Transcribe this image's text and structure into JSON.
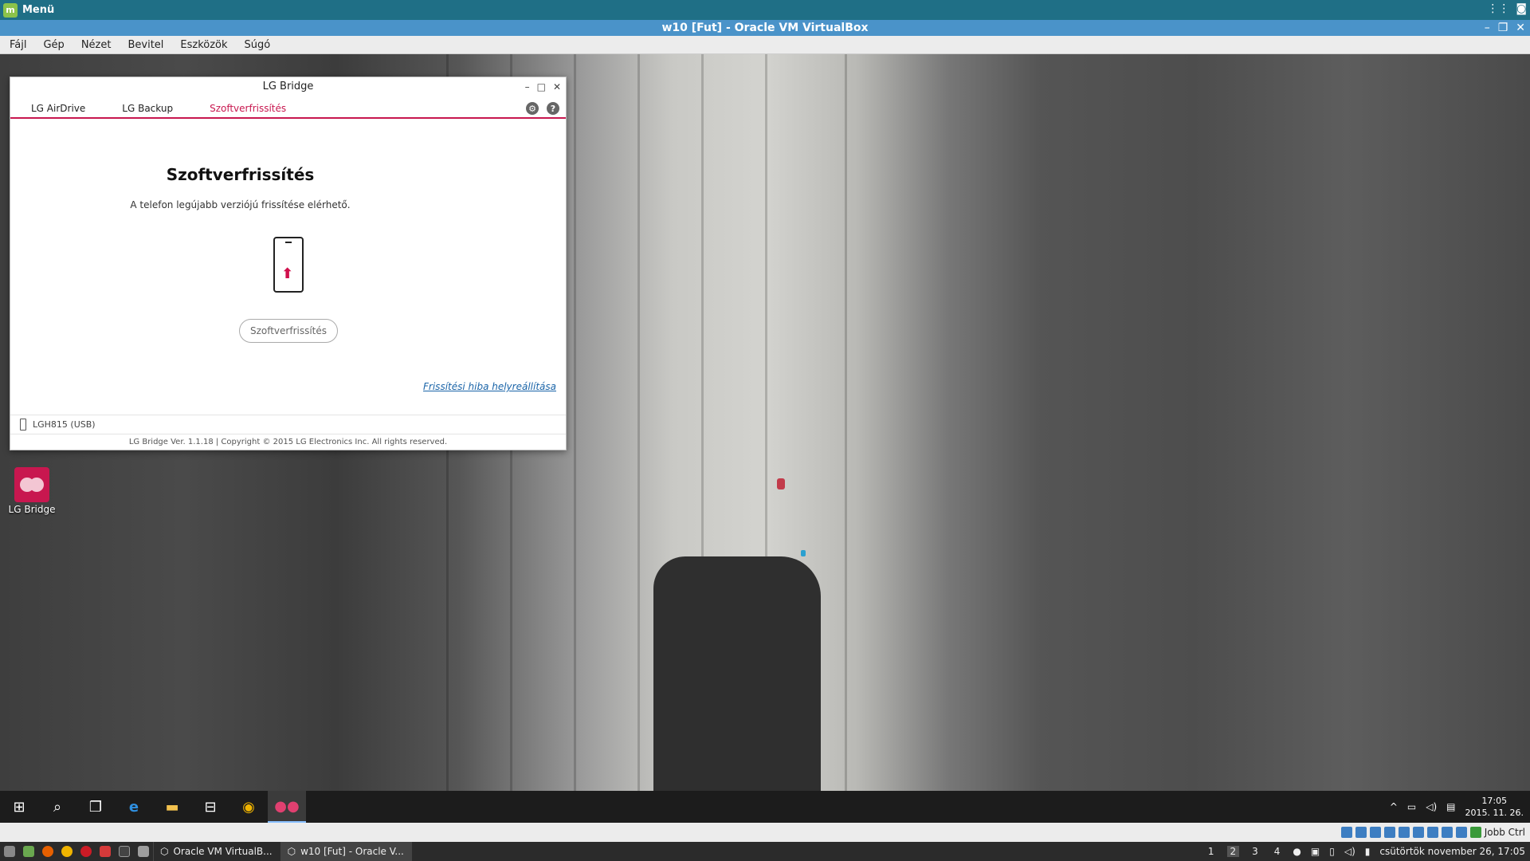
{
  "host_top": {
    "menu_label": "Menü"
  },
  "vbox": {
    "title": "w10 [Fut] - Oracle VM VirtualBox",
    "menu": [
      "Fájl",
      "Gép",
      "Nézet",
      "Bevitel",
      "Eszközök",
      "Súgó"
    ],
    "host_key_label": "Jobb Ctrl"
  },
  "desktop": {
    "lg_bridge_label": "LG Bridge"
  },
  "lg_bridge": {
    "title": "LG Bridge",
    "tabs": [
      "LG AirDrive",
      "LG Backup",
      "Szoftverfrissítés"
    ],
    "active_tab": "Szoftverfrissítés",
    "heading": "Szoftverfrissítés",
    "description": "A telefon legújabb verziójú frissítése elérhető.",
    "update_button": "Szoftverfrissítés",
    "repair_link": "Frissítési hiba helyreállítása",
    "device": "LGH815 (USB)",
    "footer": "LG Bridge Ver. 1.1.18 | Copyright © 2015 LG Electronics Inc. All rights reserved."
  },
  "guest_taskbar": {
    "time": "17:05",
    "date": "2015. 11. 26."
  },
  "host_bottom": {
    "tasks": [
      "Oracle VM VirtualB...",
      "w10 [Fut] - Oracle V..."
    ],
    "workspaces": [
      "1",
      "2",
      "3",
      "4"
    ],
    "active_workspace": "2",
    "datetime": "csütörtök november 26, 17:05"
  },
  "colors": {
    "lg_accent": "#c8174f",
    "host_panel": "#1f6f86",
    "vbox_title": "#4a93c9"
  }
}
